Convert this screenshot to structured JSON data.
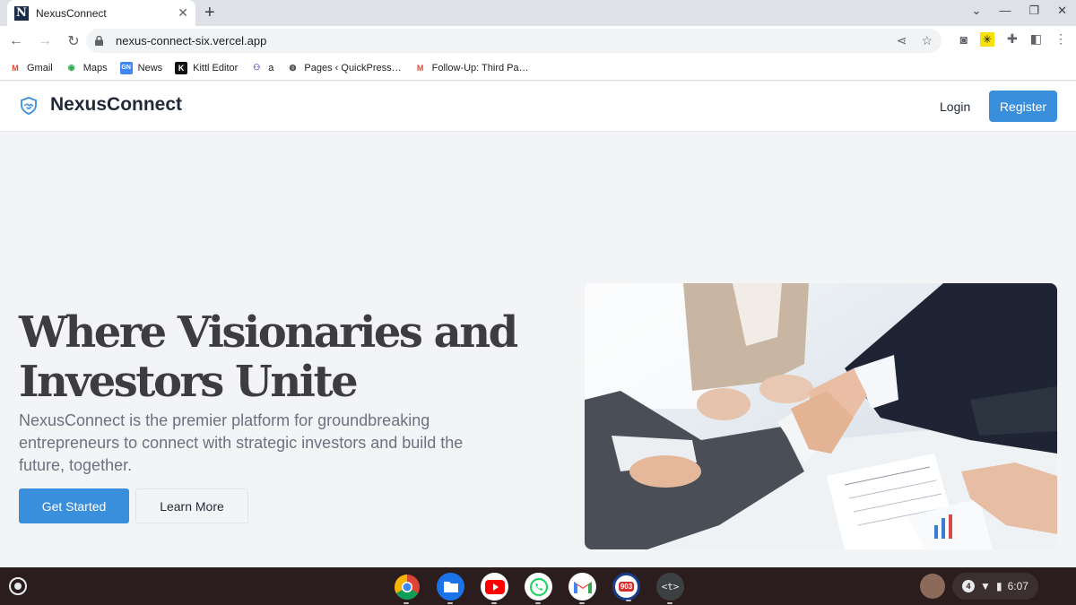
{
  "browser": {
    "tab_title": "NexusConnect",
    "tab_favicon_letter": "N",
    "new_tab_label": "+",
    "url": "nexus-connect-six.vercel.app",
    "bookmarks": [
      {
        "label": "Gmail",
        "icon": "gmail-icon"
      },
      {
        "label": "Maps",
        "icon": "maps-icon"
      },
      {
        "label": "News",
        "icon": "news-icon"
      },
      {
        "label": "Kittl Editor",
        "icon": "kittl-icon"
      },
      {
        "label": "a",
        "icon": "teams-icon"
      },
      {
        "label": "Pages ‹ QuickPress…",
        "icon": "wordpress-icon"
      },
      {
        "label": "Follow-Up: Third Pa…",
        "icon": "gmail-icon"
      }
    ]
  },
  "site": {
    "brand": "NexusConnect",
    "nav": {
      "login": "Login",
      "register": "Register"
    },
    "hero": {
      "title": "Where Visionaries and Investors Unite",
      "description": "NexusConnect is the premier platform for groundbreaking entrepreneurs to connect with strategic investors and build the future, together.",
      "primary_cta": "Get Started",
      "secondary_cta": "Learn More",
      "image": "handshake-photo"
    },
    "colors": {
      "accent": "#3a8fdc",
      "text_dark": "#3c3c42",
      "text_muted": "#6b7280",
      "background": "#f3f4f6"
    }
  },
  "taskbar": {
    "apps": [
      "chrome-icon",
      "files-icon",
      "youtube-icon",
      "whatsapp-icon",
      "gmail-icon",
      "radio-903-icon",
      "terminal-icon"
    ],
    "radio_badge": "903",
    "terminal_label": "<t>",
    "notification_count": "4",
    "time": "6:07"
  }
}
